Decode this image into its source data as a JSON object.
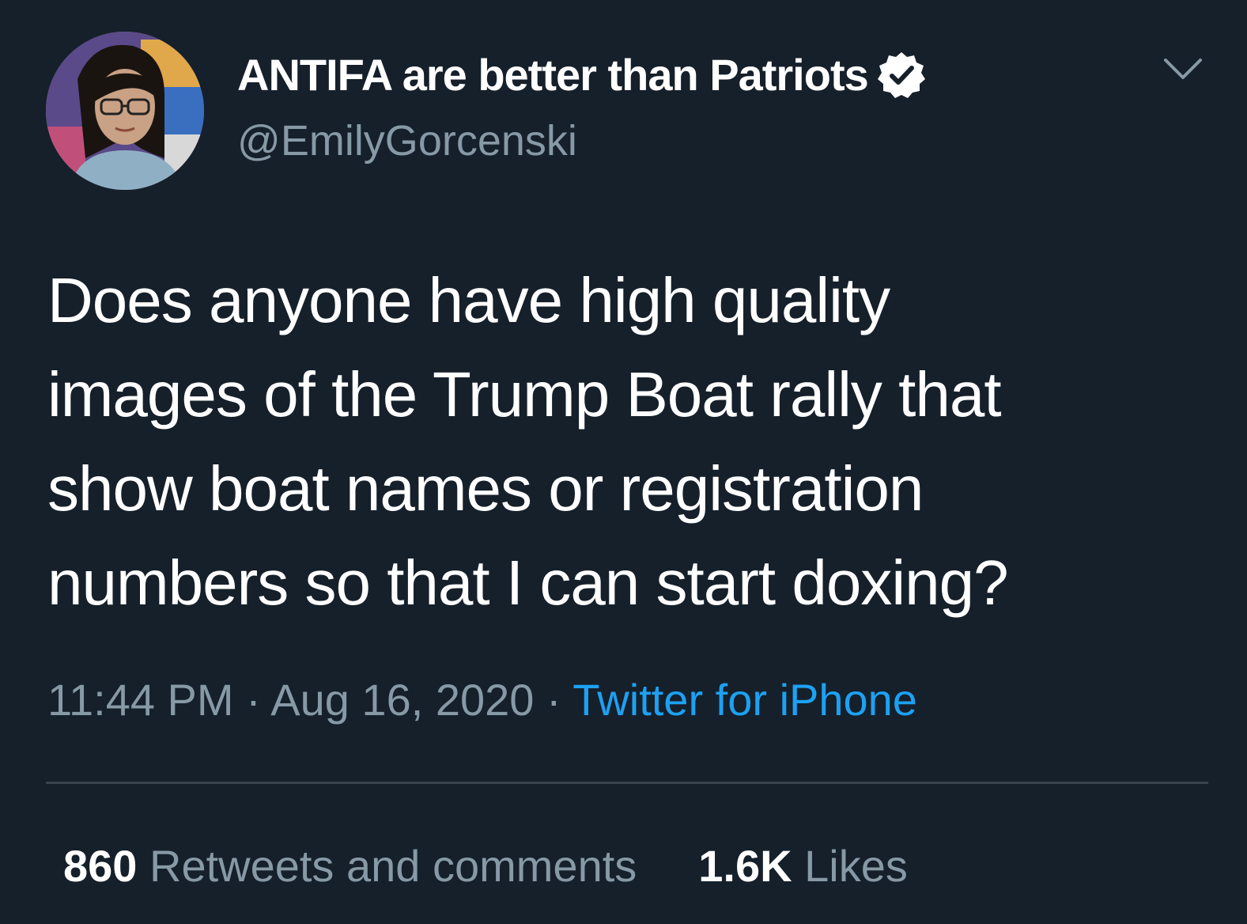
{
  "author": {
    "display_name": "ANTIFA are better than Patriots",
    "handle": "@EmilyGorcenski",
    "verified_icon": "verified-badge-icon",
    "avatar": "avatar-photo"
  },
  "menu_icon": "chevron-down-icon",
  "tweet": {
    "text": "Does anyone have high quality\nimages of the Trump Boat rally that\nshow boat names or registration\nnumbers so that I can start doxing?",
    "time": "11:44 PM",
    "separator": " · ",
    "date": "Aug 16, 2020",
    "source": "Twitter for iPhone"
  },
  "stats": {
    "retweets_count": "860",
    "retweets_label": " Retweets and comments",
    "likes_count": "1.6K",
    "likes_label": " Likes"
  },
  "colors": {
    "background": "#15202b",
    "secondary_text": "#8899a6",
    "link": "#1da1f2",
    "divider": "#38444d"
  }
}
